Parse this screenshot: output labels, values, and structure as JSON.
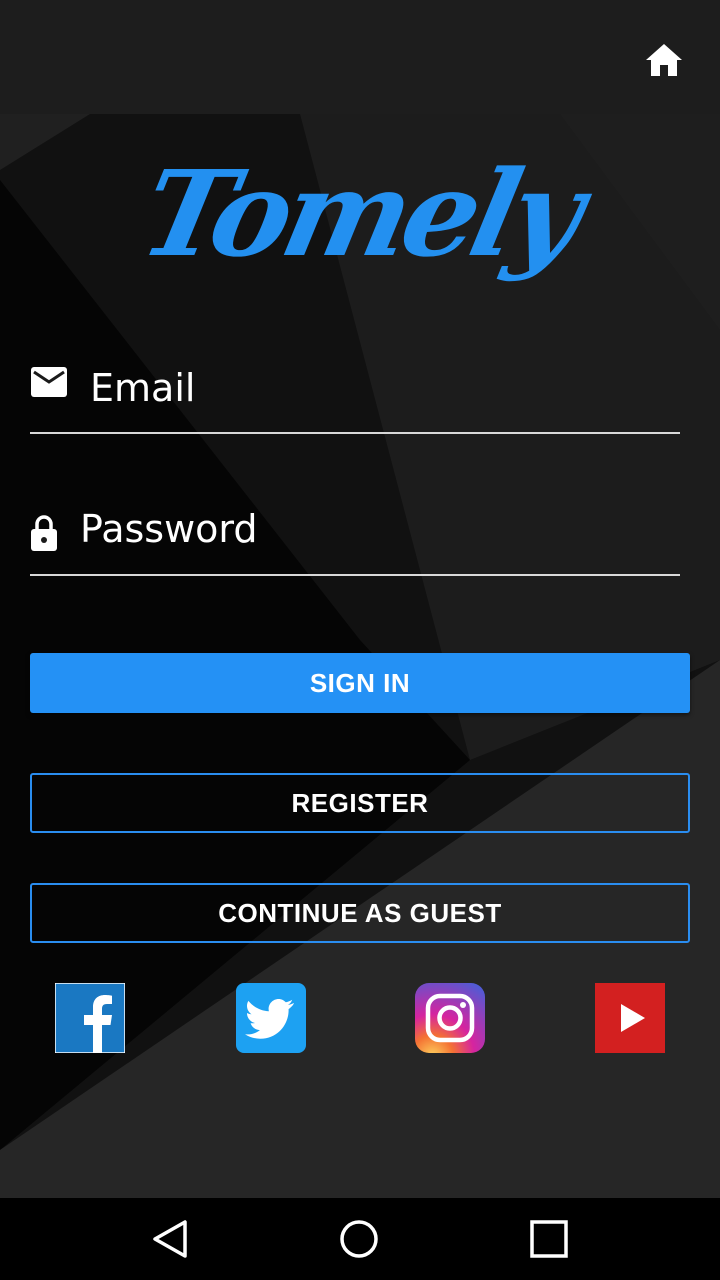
{
  "app": {
    "logo_text": "Tomely"
  },
  "form": {
    "email_placeholder": "Email",
    "email_value": "",
    "password_placeholder": "Password",
    "password_value": ""
  },
  "buttons": {
    "sign_in": "SIGN IN",
    "register": "REGISTER",
    "guest": "CONTINUE AS GUEST"
  },
  "social": [
    {
      "name": "facebook-icon",
      "color": "#1a78c2"
    },
    {
      "name": "twitter-icon",
      "color": "#1da1f2"
    },
    {
      "name": "instagram-icon",
      "color": "#c13584"
    },
    {
      "name": "youtube-icon",
      "color": "#d32020"
    }
  ],
  "colors": {
    "accent": "#2491f5",
    "logo": "#2390f0",
    "background": "#1f1f1f"
  },
  "icons": {
    "home": "home-icon",
    "email": "email-icon",
    "password": "lock-icon",
    "nav_back": "back-triangle-icon",
    "nav_home": "home-circle-icon",
    "nav_recent": "recents-square-icon"
  }
}
